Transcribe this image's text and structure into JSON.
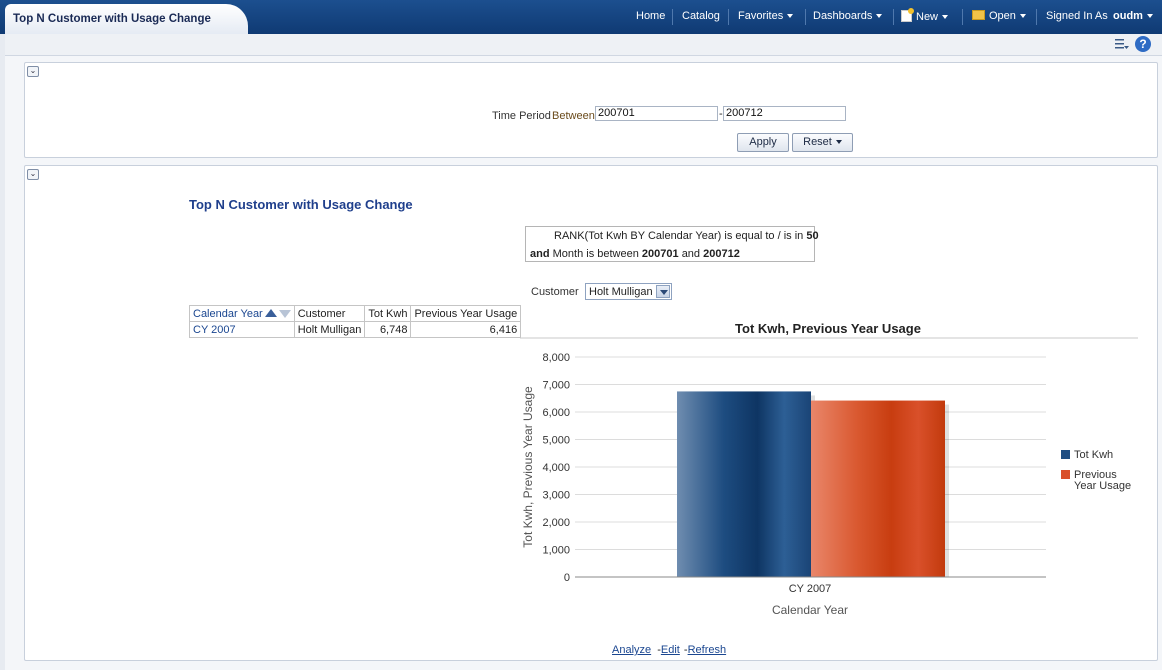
{
  "header": {
    "tab_title": "Top N Customer with Usage Change",
    "nav": {
      "home": "Home",
      "catalog": "Catalog",
      "favorites": "Favorites",
      "dashboards": "Dashboards",
      "new": "New",
      "open": "Open",
      "signed_in_as": "Signed In As",
      "user": "oudm"
    }
  },
  "prompt": {
    "label": "Time Period",
    "operator": "Between",
    "from_value": "200701",
    "dash": "-",
    "to_value": "200712",
    "apply": "Apply",
    "reset": "Reset"
  },
  "report": {
    "title": "Top N Customer with Usage Change",
    "filter": {
      "line1_prefix": "RANK(Tot Kwh BY Calendar Year) is equal to / is in",
      "rank_value": "50",
      "and": "and",
      "month_text": "Month is between",
      "from": "200701",
      "and2": "and",
      "to": "200712"
    },
    "customer_label": "Customer",
    "customer_selected": "Holt Mulligan",
    "table": {
      "headers": [
        "Calendar Year",
        "Customer",
        "Tot Kwh",
        "Previous Year Usage"
      ],
      "rows": [
        [
          "CY 2007",
          "Holt Mulligan",
          "6,748",
          "6,416"
        ]
      ]
    },
    "footer": {
      "analyze": "Analyze",
      "edit": "Edit",
      "refresh": "Refresh",
      "sep1": "-",
      "sep2": "-"
    }
  },
  "chart_data": {
    "type": "bar",
    "title": "Tot Kwh, Previous Year Usage",
    "xlabel": "Calendar Year",
    "ylabel": "Tot Kwh, Previous Year Usage",
    "categories": [
      "CY 2007"
    ],
    "series": [
      {
        "name": "Tot Kwh",
        "values": [
          6748
        ],
        "color": "#1f4e82"
      },
      {
        "name": "Previous Year Usage",
        "values": [
          6416
        ],
        "color": "#d9502a"
      }
    ],
    "legend_lines": [
      [
        "Tot Kwh"
      ],
      [
        "Previous",
        "Year Usage"
      ]
    ],
    "ylim": [
      0,
      8000
    ],
    "yticks": [
      0,
      1000,
      2000,
      3000,
      4000,
      5000,
      6000,
      7000,
      8000
    ],
    "ytick_labels": [
      "0",
      "1,000",
      "2,000",
      "3,000",
      "4,000",
      "5,000",
      "6,000",
      "7,000",
      "8,000"
    ],
    "grid": true,
    "legend_position": "right"
  },
  "colors": {
    "header_bg": "#0f3a73",
    "link": "#1a4690",
    "title": "#1f3f8c"
  }
}
